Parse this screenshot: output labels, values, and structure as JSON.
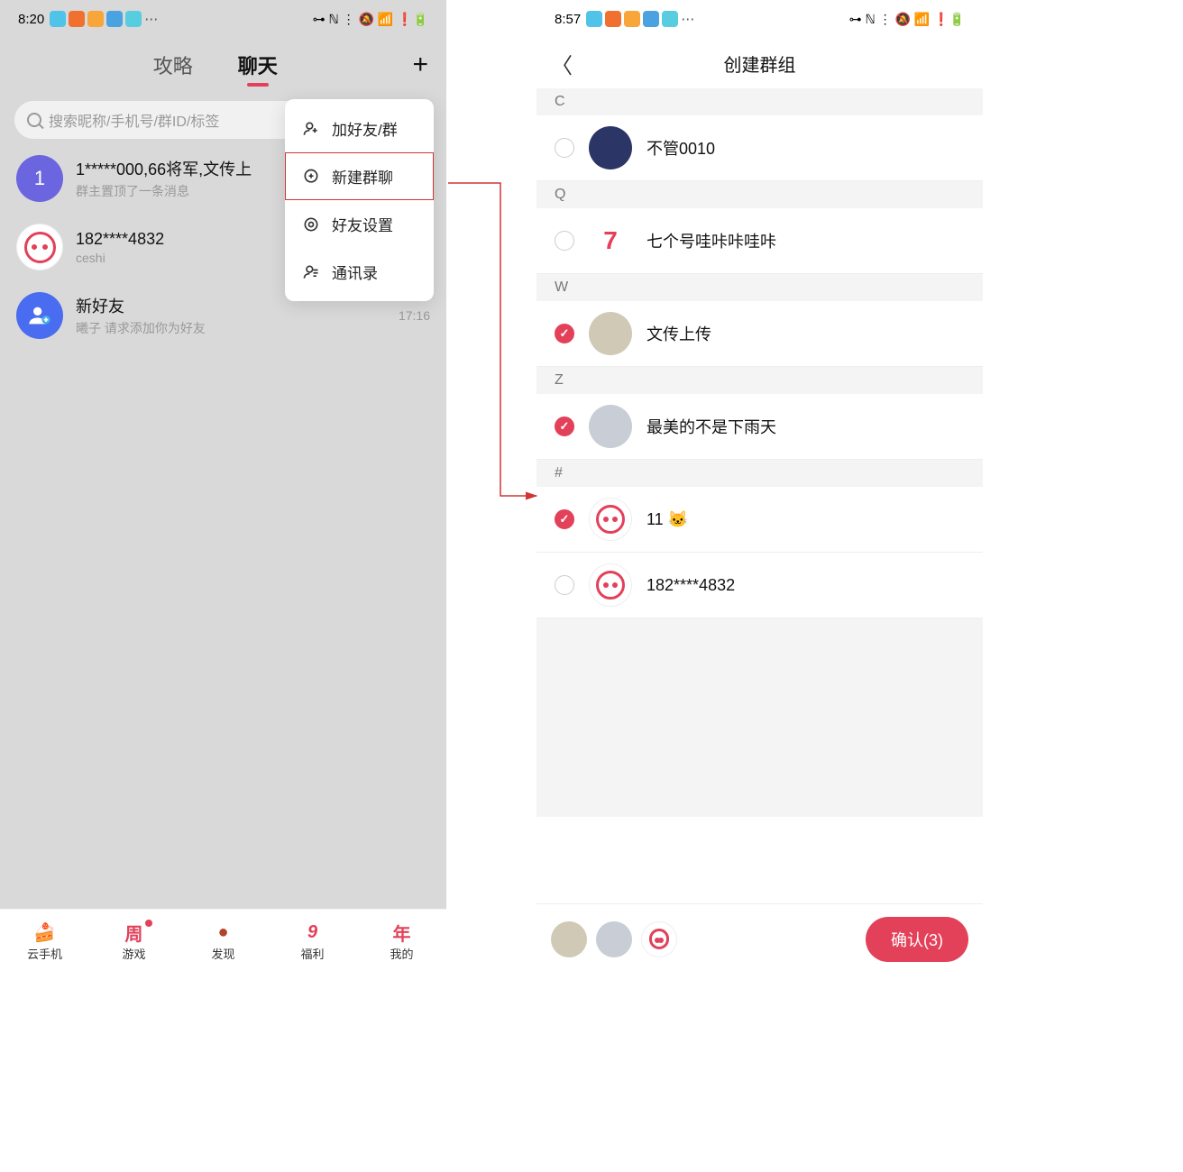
{
  "left": {
    "status_time": "8:20",
    "status_icons_left": [
      "diamond",
      "orange",
      "play",
      "book",
      "cyan",
      "more"
    ],
    "status_right": "⊶ ℕ ⋮ 🔕 📶 ❗🔋",
    "tabs": {
      "strategy": "攻略",
      "chat": "聊天"
    },
    "plus": "+",
    "search_placeholder": "搜索昵称/手机号/群ID/标签",
    "chats": [
      {
        "avatar_text": "1",
        "avatar_cls": "av-purple",
        "title": "1*****000,66将军,文传上",
        "sub": "群主置顶了一条消息",
        "time": ""
      },
      {
        "avatar_text": "",
        "avatar_cls": "av-bot",
        "title": "182****4832",
        "sub": "ceshi",
        "time": ""
      },
      {
        "avatar_text": "",
        "avatar_cls": "av-blue",
        "title": "新好友",
        "sub": "曦子 请求添加你为好友",
        "time": "17:16",
        "has_add_badge": true
      }
    ],
    "dropdown": [
      {
        "icon": "person-plus",
        "label": "加好友/群"
      },
      {
        "icon": "chat-plus",
        "label": "新建群聊",
        "highlight": true
      },
      {
        "icon": "gear",
        "label": "好友设置"
      },
      {
        "icon": "contacts",
        "label": "通讯录"
      }
    ],
    "bottom_nav": [
      {
        "icon": "🍰",
        "label": "云手机"
      },
      {
        "icon": "周",
        "label": "游戏",
        "dot": true,
        "color": "#e34059"
      },
      {
        "icon": "●",
        "label": "发现",
        "color": "#b0452e"
      },
      {
        "icon": "9",
        "label": "福利",
        "color": "#e34059"
      },
      {
        "icon": "年",
        "label": "我的",
        "color": "#e34059"
      }
    ]
  },
  "right": {
    "status_time": "8:57",
    "status_right": "⊶ ℕ ⋮ 🔕 📶 ❗🔋",
    "title": "创建群组",
    "sections": [
      {
        "letter": "C",
        "contacts": [
          {
            "name": "不管0010",
            "checked": false,
            "av": "av-tom"
          }
        ]
      },
      {
        "letter": "Q",
        "contacts": [
          {
            "name": "七个号哇咔咔哇咔",
            "checked": false,
            "av": "av-seven",
            "av_text": "7"
          }
        ]
      },
      {
        "letter": "W",
        "contacts": [
          {
            "name": "文传上传",
            "checked": true,
            "av": "av-photo1"
          }
        ]
      },
      {
        "letter": "Z",
        "contacts": [
          {
            "name": "最美的不是下雨天",
            "checked": true,
            "av": "av-photo2"
          }
        ]
      },
      {
        "letter": "#",
        "contacts": [
          {
            "name": "11 🐱",
            "checked": true,
            "av": "av-bot"
          },
          {
            "name": "182****4832",
            "checked": false,
            "av": "av-bot"
          }
        ]
      }
    ],
    "selected_minis": [
      "av-photo1",
      "av-photo2",
      "av-bot"
    ],
    "confirm_label": "确认(3)"
  }
}
